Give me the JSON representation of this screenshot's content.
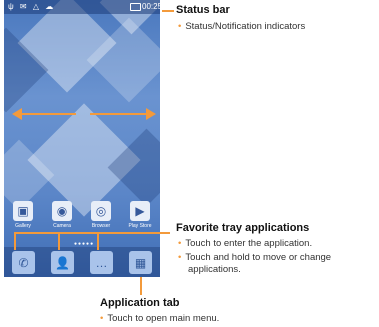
{
  "phone": {
    "status_time": "00:25",
    "status_icons": "ψ ✉ △ ☁",
    "favorites": [
      {
        "label": "Gallery",
        "icon": "▣"
      },
      {
        "label": "Camera",
        "icon": "◉"
      },
      {
        "label": "Browser",
        "icon": "◎"
      },
      {
        "label": "Play Store",
        "icon": "▶"
      }
    ],
    "page_dots": "●●●●●",
    "dock": [
      {
        "icon": "✆"
      },
      {
        "icon": "👤"
      },
      {
        "icon": "…"
      },
      {
        "icon": "▦"
      }
    ]
  },
  "callouts": {
    "status_bar": {
      "title": "Status bar",
      "bullets": [
        "Status/Notification indicators"
      ]
    },
    "favorite_tray": {
      "title": "Favorite tray applications",
      "bullets": [
        "Touch to enter the application.",
        "Touch and hold to move or change applications."
      ]
    },
    "application_tab": {
      "title": "Application tab",
      "bullets": [
        "Touch to open main menu."
      ]
    }
  },
  "colors": {
    "accent": "#f39a3b",
    "screen_blue": "#4a78be"
  }
}
